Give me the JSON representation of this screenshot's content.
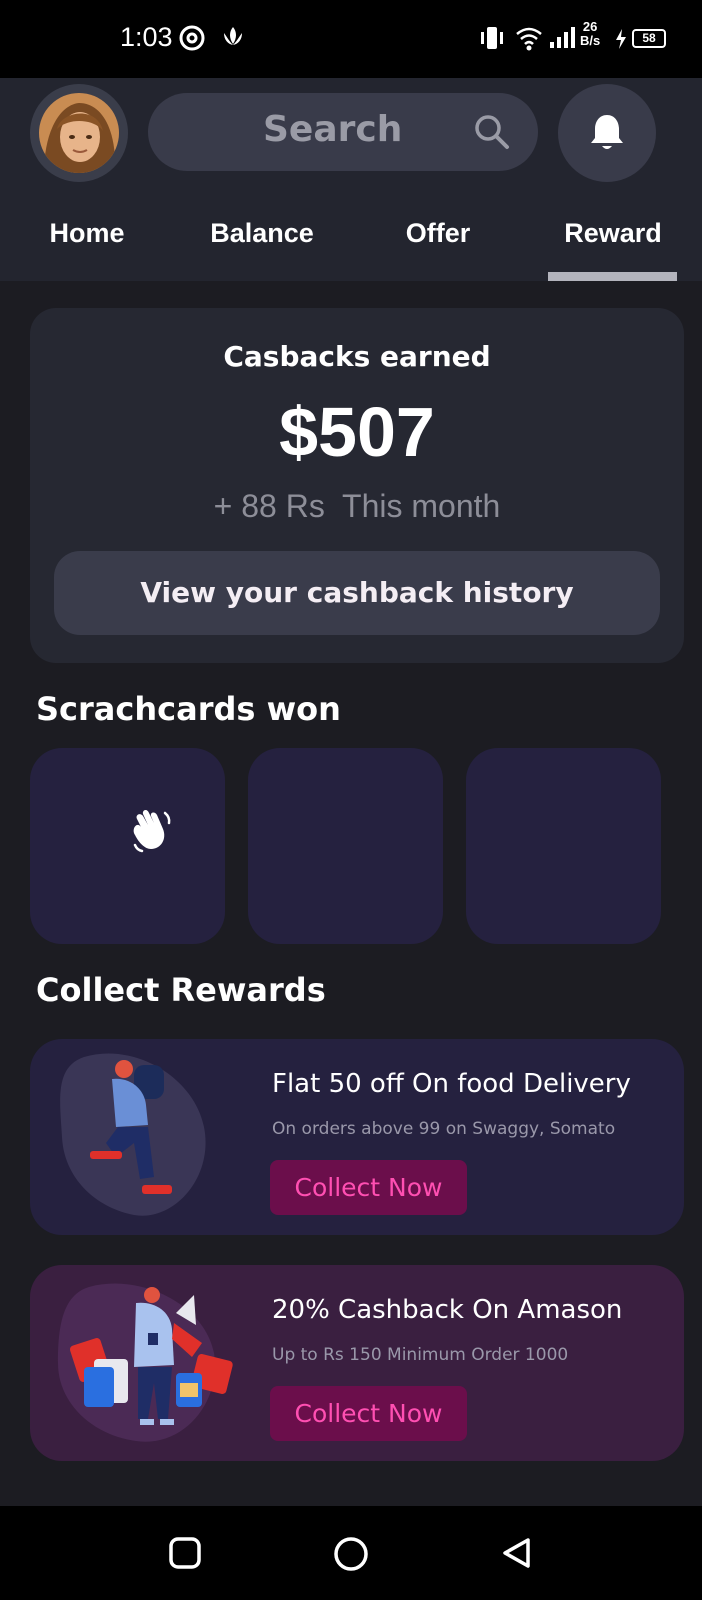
{
  "status_bar": {
    "time": "1:03",
    "net_speed_value": "26",
    "net_speed_unit": "B/s",
    "battery": "58"
  },
  "header": {
    "search_placeholder": "Search"
  },
  "tabs": [
    {
      "label": "Home"
    },
    {
      "label": "Balance"
    },
    {
      "label": "Offer"
    },
    {
      "label": "Reward",
      "active": true
    }
  ],
  "cashback": {
    "title": "Casbacks earned",
    "amount": "$507",
    "month_delta": "+ 88 Rs  This month",
    "history_button": "View your cashback history"
  },
  "scratchcards": {
    "title": "Scrachcards won",
    "cards": [
      {
        "icon": "waving-hand-icon"
      },
      {
        "icon": ""
      },
      {
        "icon": ""
      }
    ]
  },
  "rewards": {
    "title": "Collect Rewards",
    "items": [
      {
        "title": "Flat 50 off On food Delivery",
        "subtitle": "On orders above 99 on Swaggy, Somato",
        "button": "Collect Now"
      },
      {
        "title": "20% Cashback On Amason",
        "subtitle": "Up to Rs 150 Minimum Order 1000",
        "button": "Collect Now"
      }
    ]
  },
  "colors": {
    "background": "#1c1c22",
    "header": "#23252f",
    "card": "#262832",
    "scratch_card": "#25213f",
    "reward_card_2": "#3a1f40",
    "collect_button": "#6b0e4b",
    "collect_text": "#ff4fb2"
  }
}
